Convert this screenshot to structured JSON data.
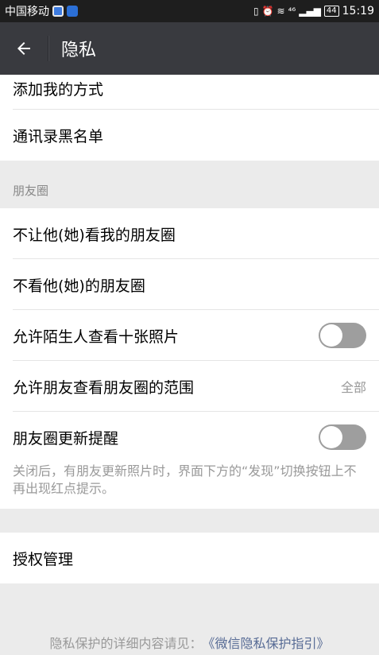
{
  "status_bar": {
    "carrier": "中国移动",
    "signal_label": "⁴⁶",
    "battery": "44",
    "time": "15:19"
  },
  "nav": {
    "title": "隐私"
  },
  "items": {
    "add_me_methods": "添加我的方式",
    "contacts_blacklist": "通讯录黑名单",
    "moments_section": "朋友圈",
    "dont_let_see": "不让他(她)看我的朋友圈",
    "dont_see": "不看他(她)的朋友圈",
    "stranger_ten_photos": "允许陌生人查看十张照片",
    "friend_view_range": "允许朋友查看朋友圈的范围",
    "friend_view_range_value": "全部",
    "moments_update_reminder": "朋友圈更新提醒",
    "reminder_note": "关闭后，有朋友更新照片时，界面下方的“发现”切换按钮上不再出现红点提示。",
    "authorization_manage": "授权管理"
  },
  "toggles": {
    "stranger_ten_photos": false,
    "moments_update_reminder": false
  },
  "footer": {
    "prefix": "隐私保护的详细内容请见：",
    "link": "《微信隐私保护指引》"
  },
  "colors": {
    "nav_bg": "#393a3f",
    "status_bg": "#1e1e1e",
    "page_bg": "#ebebeb",
    "toggle_off": "#9e9e9e",
    "link": "#576b95"
  }
}
